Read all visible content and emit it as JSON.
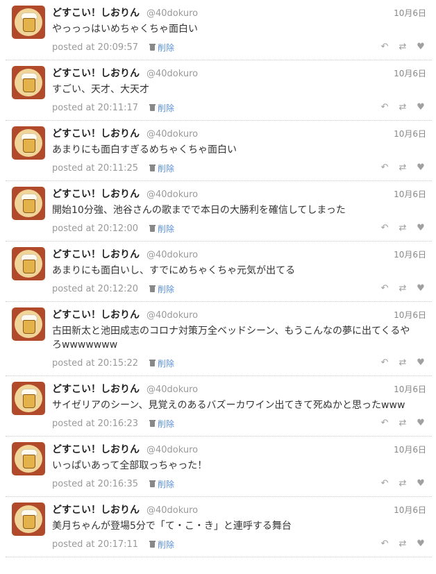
{
  "tweets": [
    {
      "name": "どすこい！しおりん",
      "handle": "@40dokuro",
      "date": "10月6日",
      "text": "やっっっはいめちゃくちゃ面白い",
      "posted": "posted at 20:09:57",
      "delete": "削除"
    },
    {
      "name": "どすこい！しおりん",
      "handle": "@40dokuro",
      "date": "10月6日",
      "text": "すごい、天才、大天才",
      "posted": "posted at 20:11:17",
      "delete": "削除"
    },
    {
      "name": "どすこい！しおりん",
      "handle": "@40dokuro",
      "date": "10月6日",
      "text": "あまりにも面白すぎるめちゃくちゃ面白い",
      "posted": "posted at 20:11:25",
      "delete": "削除"
    },
    {
      "name": "どすこい！しおりん",
      "handle": "@40dokuro",
      "date": "10月6日",
      "text": "開始10分強、池谷さんの歌までで本日の大勝利を確信してしまった",
      "posted": "posted at 20:12:00",
      "delete": "削除"
    },
    {
      "name": "どすこい！しおりん",
      "handle": "@40dokuro",
      "date": "10月6日",
      "text": "あまりにも面白いし、すでにめちゃくちゃ元気が出てる",
      "posted": "posted at 20:12:20",
      "delete": "削除"
    },
    {
      "name": "どすこい！しおりん",
      "handle": "@40dokuro",
      "date": "10月6日",
      "text": "古田新太と池田成志のコロナ対策万全ベッドシーン、もうこんなの夢に出てくるやろwwwwwww",
      "posted": "posted at 20:15:22",
      "delete": "削除"
    },
    {
      "name": "どすこい！しおりん",
      "handle": "@40dokuro",
      "date": "10月6日",
      "text": "サイゼリアのシーン、見覚えのあるバズーカワイン出てきて死ぬかと思ったwww",
      "posted": "posted at 20:16:23",
      "delete": "削除"
    },
    {
      "name": "どすこい！しおりん",
      "handle": "@40dokuro",
      "date": "10月6日",
      "text": "いっぱいあって全部取っちゃった！",
      "posted": "posted at 20:16:35",
      "delete": "削除"
    },
    {
      "name": "どすこい！しおりん",
      "handle": "@40dokuro",
      "date": "10月6日",
      "text": "美月ちゃんが登場5分で「て・こ・き」と連呼する舞台",
      "posted": "posted at 20:17:11",
      "delete": "削除"
    }
  ],
  "icons": {
    "reply": "reply-icon",
    "retweet": "retweet-icon",
    "favorite": "heart-icon",
    "delete": "trash-icon",
    "avatar": "beer-mug-avatar"
  }
}
